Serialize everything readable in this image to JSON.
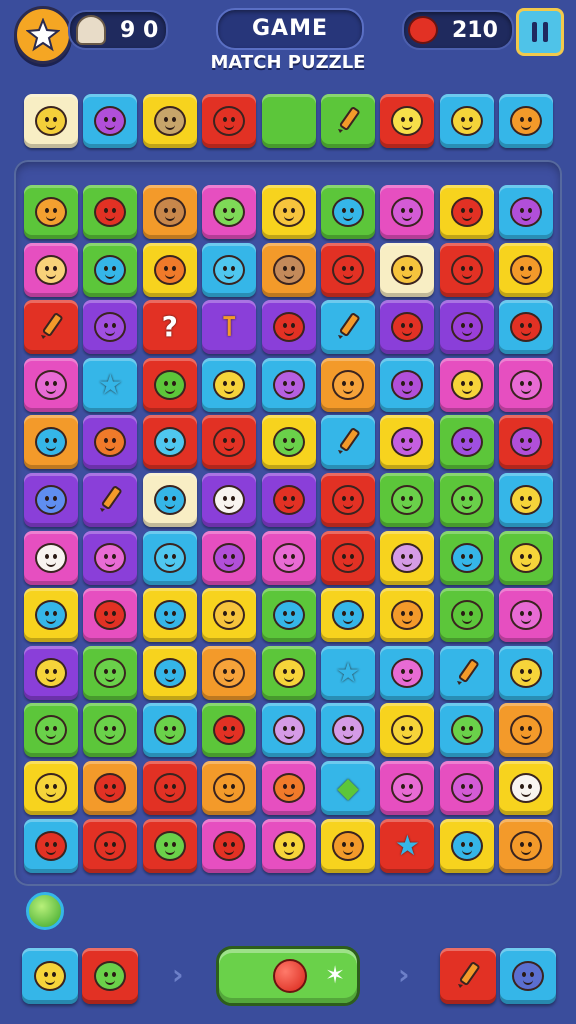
{
  "hud": {
    "moves_value": "9 0",
    "title": "GAME",
    "subtitle": "MATCH PUZZLE",
    "score_value": "210"
  },
  "icons": {
    "menu": "star-badge-icon",
    "moves": "ghost-icon",
    "score": "red-blob-icon",
    "pause": "pause-icon"
  },
  "colors": {
    "background": "#3a4d9c",
    "board": "#3e4fa0",
    "yellow": "#f7d31e",
    "green": "#5cc63a",
    "red": "#e23124",
    "orange": "#f39a2a",
    "pink": "#e64fc0",
    "blue": "#35b6e8",
    "purple": "#8a3fd9",
    "cream": "#f8eec4",
    "lime": "#66cc33"
  },
  "top_row": [
    {
      "color": "cream",
      "icon": "face",
      "face": "#f4cf3a"
    },
    {
      "color": "blue",
      "icon": "face",
      "face": "#b14fd9"
    },
    {
      "color": "yellow",
      "icon": "face",
      "face": "#c7a56a"
    },
    {
      "color": "red",
      "icon": "face",
      "face": "#e23124"
    },
    {
      "color": "green",
      "icon": "none",
      "face": ""
    },
    {
      "color": "green",
      "icon": "crayon",
      "face": ""
    },
    {
      "color": "red",
      "icon": "face",
      "face": "#f7e04a"
    },
    {
      "color": "blue",
      "icon": "face",
      "face": "#f4d43a"
    },
    {
      "color": "blue",
      "icon": "face",
      "face": "#f39a2a"
    }
  ],
  "grid": [
    [
      {
        "color": "green",
        "face": "#f3a030"
      },
      {
        "color": "green",
        "face": "#e23124"
      },
      {
        "color": "orange",
        "face": "#c8874b"
      },
      {
        "color": "pink",
        "face": "#7ed957"
      },
      {
        "color": "yellow",
        "face": "#f6c43d"
      },
      {
        "color": "green",
        "face": "#35b6e8"
      },
      {
        "color": "pink",
        "face": "#d35bd6"
      },
      {
        "color": "yellow",
        "face": "#e23124"
      },
      {
        "color": "blue",
        "face": "#b14fd9"
      }
    ],
    [
      {
        "color": "pink",
        "face": "#f8d27a"
      },
      {
        "color": "green",
        "face": "#35b6e8"
      },
      {
        "color": "yellow",
        "face": "#f07a2a"
      },
      {
        "color": "blue",
        "face": "#4fc7ef"
      },
      {
        "color": "orange",
        "face": "#c48a5a"
      },
      {
        "color": "red",
        "face": "#e23124"
      },
      {
        "color": "cream",
        "face": "#f6c43d"
      },
      {
        "color": "red",
        "face": "#e23124"
      },
      {
        "color": "yellow",
        "face": "#f39a2a"
      }
    ],
    [
      {
        "color": "red",
        "icon": "crayon"
      },
      {
        "color": "purple",
        "face": "#a04fe0"
      },
      {
        "color": "red",
        "icon": "question"
      },
      {
        "color": "purple",
        "icon": "pin"
      },
      {
        "color": "purple",
        "face": "#e23124"
      },
      {
        "color": "blue",
        "icon": "crayon"
      },
      {
        "color": "purple",
        "face": "#e23124"
      },
      {
        "color": "purple",
        "face": "#9a3fd8"
      },
      {
        "color": "blue",
        "face": "#e23124"
      }
    ],
    [
      {
        "color": "pink",
        "face": "#e86bd4"
      },
      {
        "color": "blue",
        "icon": "star"
      },
      {
        "color": "red",
        "face": "#5cc63a"
      },
      {
        "color": "blue",
        "face": "#f6d43a"
      },
      {
        "color": "blue",
        "face": "#b65fe0"
      },
      {
        "color": "orange",
        "face": "#f6a33a"
      },
      {
        "color": "blue",
        "face": "#b14fd9"
      },
      {
        "color": "pink",
        "face": "#f6d43a"
      },
      {
        "color": "pink",
        "face": "#e86bd4"
      }
    ],
    [
      {
        "color": "orange",
        "face": "#35b6e8"
      },
      {
        "color": "purple",
        "face": "#f07a2a"
      },
      {
        "color": "red",
        "face": "#4fc7ef"
      },
      {
        "color": "red",
        "face": "#e23124"
      },
      {
        "color": "yellow",
        "face": "#6ad14a"
      },
      {
        "color": "blue",
        "icon": "crayon"
      },
      {
        "color": "yellow",
        "face": "#c55fe0"
      },
      {
        "color": "green",
        "face": "#a04fe0"
      },
      {
        "color": "red",
        "face": "#b14fd9"
      }
    ],
    [
      {
        "color": "purple",
        "face": "#5f8ef0"
      },
      {
        "color": "purple",
        "icon": "crayon"
      },
      {
        "color": "cream",
        "face": "#35b6e8"
      },
      {
        "color": "purple",
        "face": "#f8f4f0"
      },
      {
        "color": "purple",
        "face": "#e23124"
      },
      {
        "color": "red",
        "face": "#e23124"
      },
      {
        "color": "green",
        "face": "#6ad14a"
      },
      {
        "color": "green",
        "face": "#6ad14a"
      },
      {
        "color": "blue",
        "face": "#f6d43a"
      }
    ],
    [
      {
        "color": "pink",
        "face": "#f8f4f0"
      },
      {
        "color": "purple",
        "face": "#e86bd4"
      },
      {
        "color": "blue",
        "face": "#4fc7ef"
      },
      {
        "color": "pink",
        "face": "#b14fd9"
      },
      {
        "color": "pink",
        "face": "#e86bd4"
      },
      {
        "color": "red",
        "face": "#e23124"
      },
      {
        "color": "yellow",
        "face": "#d59be6"
      },
      {
        "color": "green",
        "face": "#35b6e8"
      },
      {
        "color": "green",
        "face": "#f6d43a"
      }
    ],
    [
      {
        "color": "yellow",
        "face": "#35b6e8"
      },
      {
        "color": "pink",
        "face": "#e23124"
      },
      {
        "color": "yellow",
        "face": "#35b6e8"
      },
      {
        "color": "yellow",
        "face": "#f6c43d"
      },
      {
        "color": "green",
        "face": "#35b6e8"
      },
      {
        "color": "yellow",
        "face": "#35b6e8"
      },
      {
        "color": "yellow",
        "face": "#f39a2a"
      },
      {
        "color": "green",
        "face": "#5cc63a"
      },
      {
        "color": "pink",
        "face": "#e86bd4"
      }
    ],
    [
      {
        "color": "purple",
        "face": "#f6d43a"
      },
      {
        "color": "green",
        "face": "#6ad14a"
      },
      {
        "color": "yellow",
        "face": "#35b6e8"
      },
      {
        "color": "orange",
        "face": "#f6a33a"
      },
      {
        "color": "green",
        "face": "#f6d43a"
      },
      {
        "color": "blue",
        "icon": "star"
      },
      {
        "color": "blue",
        "face": "#e86bd4"
      },
      {
        "color": "blue",
        "icon": "crayon"
      },
      {
        "color": "blue",
        "face": "#f6d43a"
      }
    ],
    [
      {
        "color": "green",
        "face": "#6ad14a"
      },
      {
        "color": "green",
        "face": "#6ad14a"
      },
      {
        "color": "blue",
        "face": "#6ad14a"
      },
      {
        "color": "green",
        "face": "#e23124"
      },
      {
        "color": "blue",
        "face": "#d59be6"
      },
      {
        "color": "blue",
        "face": "#d59be6"
      },
      {
        "color": "yellow",
        "face": "#f6d43a"
      },
      {
        "color": "blue",
        "face": "#6ad14a"
      },
      {
        "color": "orange",
        "face": "#f39a2a"
      }
    ],
    [
      {
        "color": "yellow",
        "face": "#f6d43a"
      },
      {
        "color": "orange",
        "face": "#e23124"
      },
      {
        "color": "red",
        "face": "#e23124"
      },
      {
        "color": "orange",
        "face": "#f39a2a"
      },
      {
        "color": "pink",
        "face": "#f07a2a"
      },
      {
        "color": "blue",
        "icon": "gem"
      },
      {
        "color": "pink",
        "face": "#e86bd4"
      },
      {
        "color": "pink",
        "face": "#d35bd6"
      },
      {
        "color": "yellow",
        "face": "#f8f4f0"
      }
    ],
    [
      {
        "color": "blue",
        "face": "#e23124"
      },
      {
        "color": "red",
        "face": "#e23124"
      },
      {
        "color": "red",
        "face": "#6ad14a"
      },
      {
        "color": "pink",
        "face": "#e23124"
      },
      {
        "color": "pink",
        "face": "#f6d43a"
      },
      {
        "color": "yellow",
        "face": "#f39a2a"
      },
      {
        "color": "red",
        "icon": "star"
      },
      {
        "color": "yellow",
        "face": "#35b6e8"
      },
      {
        "color": "orange",
        "face": "#f39a2a"
      }
    ]
  ],
  "bottom": {
    "powerup": "green-orb-icon",
    "left_tiles": [
      {
        "color": "blue",
        "face": "#f6d43a"
      },
      {
        "color": "red",
        "face": "#6ad14a"
      }
    ],
    "right_tiles": [
      {
        "color": "red",
        "icon": "crayon"
      },
      {
        "color": "blue",
        "face": "#5b6fcf"
      }
    ],
    "play_icons": [
      "tomato-icon",
      "sparkle-icon"
    ]
  }
}
